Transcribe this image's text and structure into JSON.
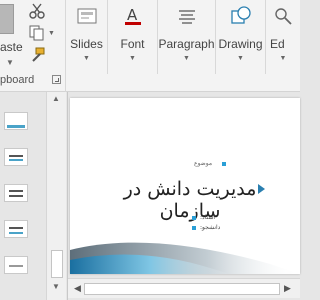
{
  "ribbon": {
    "clipboard": {
      "paste_label": "aste",
      "group_label": "pboard"
    },
    "buttons": [
      {
        "label": "Slides",
        "icon": "new-slide-icon"
      },
      {
        "label": "Font",
        "icon": "font-color-icon"
      },
      {
        "label": "Paragraph",
        "icon": "paragraph-align-icon"
      },
      {
        "label": "Drawing",
        "icon": "shapes-icon"
      },
      {
        "label": "Ed",
        "icon": "editing-icon"
      }
    ],
    "colors": {
      "accent": "#2a9fd6",
      "font_red": "#c00000"
    }
  },
  "slide": {
    "subtitle_small": "موضوع",
    "title": "مدیریت دانش در سازمان",
    "meta_line_1": "استاد:",
    "meta_line_2": "دانشجو:",
    "accent_color": "#2a9fd6"
  }
}
